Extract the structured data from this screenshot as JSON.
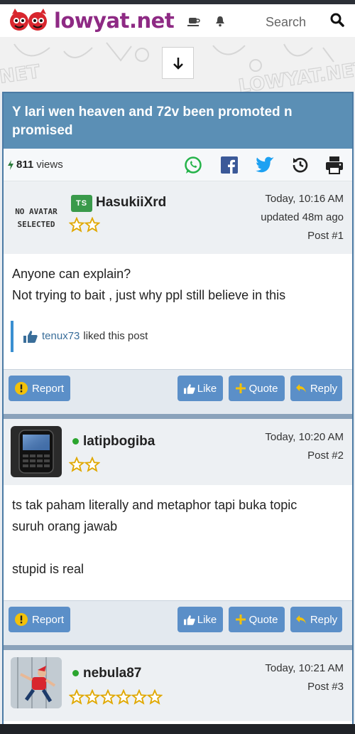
{
  "site": {
    "logo_text": "lowyat.net",
    "search_label": "Search"
  },
  "thread": {
    "title": "Y lari wen heaven and 72v been promoted n promised",
    "views_count": "811",
    "views_label": "views"
  },
  "posts": [
    {
      "username": "HasukiiXrd",
      "badge": "TS",
      "avatar_text_line1": "NO AVATAR",
      "avatar_text_line2": "SELECTED",
      "stars": 2,
      "time": "Today, 10:16 AM",
      "updated": "updated 48m ago",
      "post_number": "Post #1",
      "body": [
        "Anyone can explain?",
        "Not trying to bait , just why ppl still believe in this"
      ],
      "liked_by": "tenux73",
      "liked_suffix": "liked this post"
    },
    {
      "username": "latipbogiba",
      "stars": 2,
      "time": "Today, 10:20 AM",
      "post_number": "Post #2",
      "body": [
        "ts tak paham literally and metaphor tapi buka topic",
        "suruh orang jawab",
        "",
        "stupid is real"
      ]
    },
    {
      "username": "nebula87",
      "stars": 6,
      "time": "Today, 10:21 AM",
      "post_number": "Post #3"
    }
  ],
  "actions": {
    "report": "Report",
    "like": "Like",
    "quote": "Quote",
    "reply": "Reply"
  },
  "colors": {
    "brand": "#8e2a84",
    "header": "#5b8fb5",
    "button": "#5b8fc8",
    "online": "#2ba52e"
  }
}
